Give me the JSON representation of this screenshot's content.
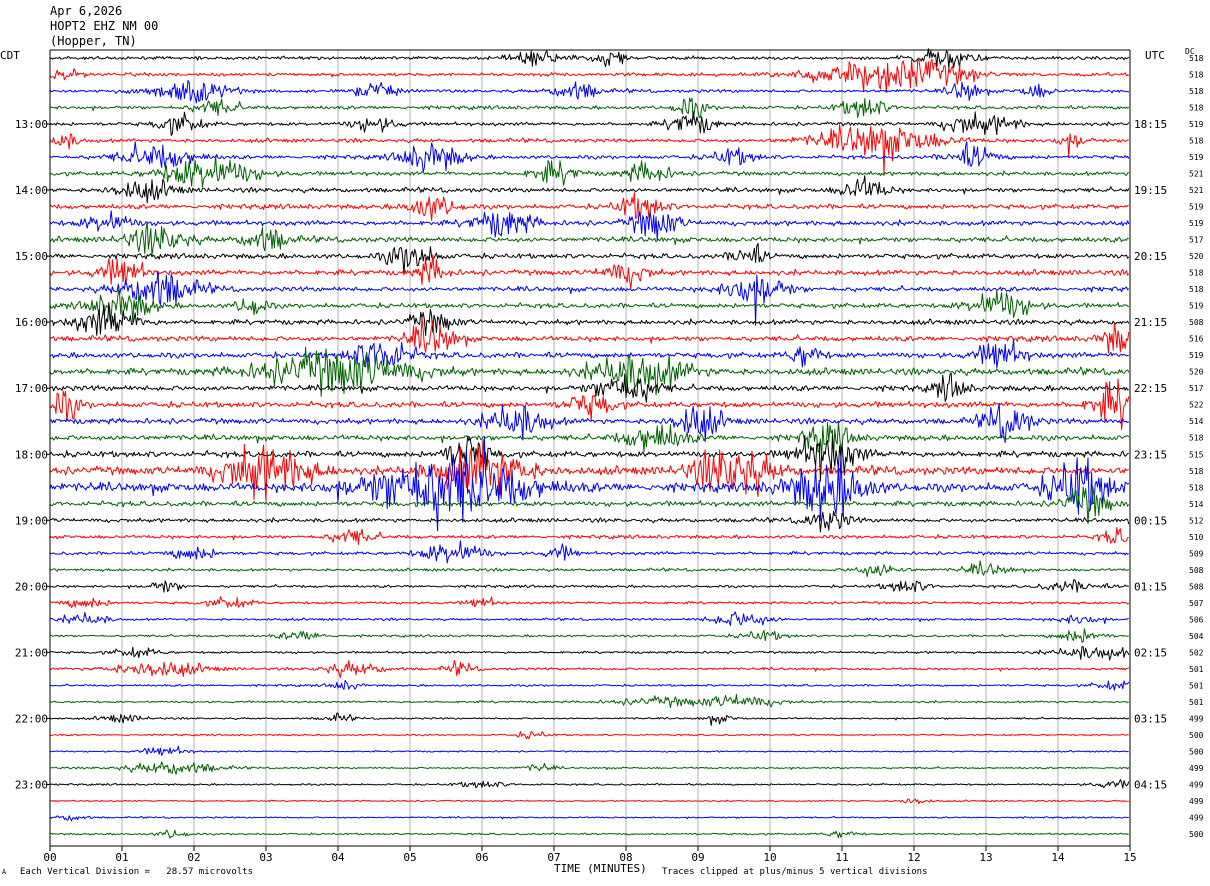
{
  "header": {
    "date": "Apr 6,2026",
    "station": "HOPT2 EHZ NM 00",
    "location": "(Hopper, TN)"
  },
  "axes": {
    "left_zone": "CDT",
    "right_zone": "UTC",
    "dc_label": "DC",
    "x_title": "TIME (MINUTES)"
  },
  "footer": {
    "scale_note": "Each Vertical Division =   28.57 microvolts",
    "clip_note": "Traces clipped at plus/minus 5 vertical divisions",
    "corner_mark": "A"
  },
  "chart_data": {
    "type": "line",
    "x_range": [
      0,
      15
    ],
    "x_ticks": [
      "00",
      "01",
      "02",
      "03",
      "04",
      "05",
      "06",
      "07",
      "08",
      "09",
      "10",
      "11",
      "12",
      "13",
      "14",
      "15"
    ],
    "row_count": 48,
    "color_cycle": [
      "#000000",
      "#ff0000",
      "#0000ff",
      "#006400"
    ],
    "left_time_labels": [
      {
        "row": 4,
        "label": "13:00"
      },
      {
        "row": 8,
        "label": "14:00"
      },
      {
        "row": 12,
        "label": "15:00"
      },
      {
        "row": 16,
        "label": "16:00"
      },
      {
        "row": 20,
        "label": "17:00"
      },
      {
        "row": 24,
        "label": "18:00"
      },
      {
        "row": 28,
        "label": "19:00"
      },
      {
        "row": 32,
        "label": "20:00"
      },
      {
        "row": 36,
        "label": "21:00"
      },
      {
        "row": 40,
        "label": "22:00"
      },
      {
        "row": 44,
        "label": "23:00"
      }
    ],
    "right_time_labels": [
      {
        "row": 4,
        "label": "18:15"
      },
      {
        "row": 8,
        "label": "19:15"
      },
      {
        "row": 12,
        "label": "20:15"
      },
      {
        "row": 16,
        "label": "21:15"
      },
      {
        "row": 20,
        "label": "22:15"
      },
      {
        "row": 24,
        "label": "23:15"
      },
      {
        "row": 28,
        "label": "00:15"
      },
      {
        "row": 32,
        "label": "01:15"
      },
      {
        "row": 36,
        "label": "02:15"
      },
      {
        "row": 40,
        "label": "03:15"
      },
      {
        "row": 44,
        "label": "04:15"
      }
    ],
    "dc_offsets": [
      "518",
      "518",
      "518",
      "518",
      "519",
      "518",
      "519",
      "521",
      "521",
      "519",
      "519",
      "517",
      "520",
      "518",
      "518",
      "519",
      "508",
      "516",
      "519",
      "520",
      "517",
      "522",
      "514",
      "518",
      "515",
      "518",
      "518",
      "514",
      "512",
      "510",
      "509",
      "508",
      "508",
      "507",
      "506",
      "504",
      "502",
      "501",
      "501",
      "501",
      "499",
      "500",
      "500",
      "499",
      "499",
      "499",
      "499",
      "500"
    ],
    "activity": [
      {
        "row": 0,
        "level": 1.2,
        "bursts": [
          [
            6.8,
            0.4,
            2
          ],
          [
            7.8,
            0.2,
            2.5
          ],
          [
            12.4,
            0.4,
            3
          ]
        ]
      },
      {
        "row": 1,
        "level": 1.3,
        "bursts": [
          [
            0.2,
            0.2,
            2
          ],
          [
            11.2,
            0.7,
            4
          ],
          [
            12.2,
            0.6,
            4
          ]
        ]
      },
      {
        "row": 2,
        "level": 1.3,
        "bursts": [
          [
            1.9,
            0.5,
            3.5
          ],
          [
            4.5,
            0.3,
            2
          ],
          [
            7.3,
            0.3,
            2.5
          ],
          [
            12.7,
            0.2,
            3
          ],
          [
            13.7,
            0.2,
            2
          ]
        ]
      },
      {
        "row": 3,
        "level": 1.4,
        "bursts": [
          [
            2.3,
            0.3,
            2
          ],
          [
            8.9,
            0.2,
            3
          ],
          [
            11.3,
            0.3,
            3
          ]
        ]
      },
      {
        "row": 4,
        "level": 1.4,
        "bursts": [
          [
            1.8,
            0.3,
            2.5
          ],
          [
            4.5,
            0.3,
            2
          ],
          [
            8.9,
            0.3,
            3
          ],
          [
            12.7,
            0.3,
            2.5
          ],
          [
            13.2,
            0.3,
            2
          ]
        ]
      },
      {
        "row": 5,
        "level": 1.5,
        "bursts": [
          [
            0.2,
            0.2,
            2
          ],
          [
            11.5,
            0.8,
            4
          ],
          [
            14.2,
            0.2,
            2
          ]
        ]
      },
      {
        "row": 6,
        "level": 1.5,
        "bursts": [
          [
            1.5,
            0.5,
            3
          ],
          [
            5.3,
            0.4,
            3.5
          ],
          [
            9.5,
            0.3,
            2
          ],
          [
            12.8,
            0.3,
            3
          ]
        ]
      },
      {
        "row": 7,
        "level": 1.6,
        "bursts": [
          [
            2.2,
            0.6,
            4
          ],
          [
            7.0,
            0.3,
            2.5
          ],
          [
            8.3,
            0.3,
            2.5
          ]
        ]
      },
      {
        "row": 8,
        "level": 1.8,
        "bursts": [
          [
            1.3,
            0.4,
            2
          ],
          [
            11.3,
            0.3,
            2.5
          ]
        ]
      },
      {
        "row": 9,
        "level": 1.9,
        "bursts": [
          [
            5.3,
            0.3,
            2.5
          ],
          [
            8.2,
            0.3,
            2.5
          ]
        ]
      },
      {
        "row": 10,
        "level": 2.0,
        "bursts": [
          [
            0.8,
            0.3,
            2
          ],
          [
            6.3,
            0.4,
            2.5
          ],
          [
            8.4,
            0.3,
            3
          ]
        ]
      },
      {
        "row": 11,
        "level": 2.1,
        "bursts": [
          [
            1.5,
            0.4,
            2.5
          ],
          [
            3.0,
            0.3,
            2
          ]
        ]
      },
      {
        "row": 12,
        "level": 2.0,
        "bursts": [
          [
            5.0,
            0.3,
            3
          ],
          [
            9.7,
            0.2,
            2.5
          ]
        ]
      },
      {
        "row": 13,
        "level": 2.1,
        "bursts": [
          [
            1.0,
            0.3,
            2.5
          ],
          [
            5.3,
            0.2,
            2.5
          ],
          [
            8.0,
            0.3,
            2
          ]
        ]
      },
      {
        "row": 14,
        "level": 1.9,
        "bursts": [
          [
            1.5,
            0.5,
            3.5
          ],
          [
            9.8,
            0.4,
            3.5
          ]
        ]
      },
      {
        "row": 15,
        "level": 1.9,
        "bursts": [
          [
            1.0,
            0.4,
            3
          ],
          [
            2.8,
            0.2,
            2
          ],
          [
            13.2,
            0.4,
            3
          ]
        ]
      },
      {
        "row": 16,
        "level": 2.0,
        "bursts": [
          [
            0.8,
            0.4,
            3
          ],
          [
            5.3,
            0.3,
            2
          ]
        ]
      },
      {
        "row": 17,
        "level": 2.1,
        "bursts": [
          [
            5.3,
            0.3,
            3
          ],
          [
            14.8,
            0.2,
            2.5
          ]
        ]
      },
      {
        "row": 18,
        "level": 2.2,
        "bursts": [
          [
            4.6,
            0.4,
            3
          ],
          [
            10.5,
            0.2,
            2
          ],
          [
            13.2,
            0.3,
            2.5
          ]
        ]
      },
      {
        "row": 19,
        "level": 2.6,
        "bursts": [
          [
            4.0,
            1.0,
            3
          ],
          [
            8.2,
            0.6,
            3
          ]
        ]
      },
      {
        "row": 20,
        "level": 2.2,
        "bursts": [
          [
            8.0,
            0.4,
            3
          ],
          [
            12.5,
            0.2,
            2
          ]
        ]
      },
      {
        "row": 21,
        "level": 2.3,
        "bursts": [
          [
            0.2,
            0.2,
            2.5
          ],
          [
            7.5,
            0.3,
            2
          ],
          [
            14.8,
            0.3,
            3.5
          ]
        ]
      },
      {
        "row": 22,
        "level": 2.2,
        "bursts": [
          [
            6.5,
            0.4,
            3
          ],
          [
            9.0,
            0.3,
            3
          ],
          [
            13.3,
            0.3,
            3
          ]
        ]
      },
      {
        "row": 23,
        "level": 2.2,
        "bursts": [
          [
            8.4,
            0.4,
            2.5
          ],
          [
            10.8,
            0.3,
            2.5
          ]
        ]
      },
      {
        "row": 24,
        "level": 2.4,
        "bursts": [
          [
            5.8,
            0.3,
            3
          ],
          [
            10.8,
            0.4,
            3.5
          ]
        ]
      },
      {
        "row": 25,
        "level": 3.2,
        "bursts": [
          [
            3.0,
            0.6,
            3
          ],
          [
            6.0,
            0.6,
            3
          ],
          [
            9.5,
            0.5,
            3
          ]
        ]
      },
      {
        "row": 26,
        "level": 3.5,
        "bursts": [
          [
            5.5,
            1.0,
            4
          ],
          [
            10.8,
            0.5,
            3
          ],
          [
            14.3,
            0.4,
            3
          ]
        ]
      },
      {
        "row": 27,
        "level": 2.0,
        "bursts": [
          [
            14.4,
            0.3,
            3
          ]
        ]
      },
      {
        "row": 28,
        "level": 1.6,
        "bursts": [
          [
            10.8,
            0.3,
            2.5
          ]
        ]
      },
      {
        "row": 29,
        "level": 1.4,
        "bursts": [
          [
            4.2,
            0.3,
            2
          ],
          [
            14.8,
            0.2,
            2
          ]
        ]
      },
      {
        "row": 30,
        "level": 1.3,
        "bursts": [
          [
            2.0,
            0.3,
            2
          ],
          [
            5.6,
            0.4,
            3.5
          ],
          [
            7.1,
            0.2,
            2
          ]
        ]
      },
      {
        "row": 31,
        "level": 1.1,
        "bursts": [
          [
            11.5,
            0.3,
            2.5
          ],
          [
            13.0,
            0.3,
            2
          ]
        ]
      },
      {
        "row": 32,
        "level": 1.0,
        "bursts": [
          [
            1.6,
            0.2,
            2.5
          ],
          [
            11.9,
            0.3,
            2.5
          ],
          [
            14.2,
            0.4,
            2
          ]
        ]
      },
      {
        "row": 33,
        "level": 1.0,
        "bursts": [
          [
            0.5,
            0.3,
            2
          ],
          [
            2.5,
            0.3,
            2
          ],
          [
            6.0,
            0.2,
            2
          ]
        ]
      },
      {
        "row": 34,
        "level": 0.9,
        "bursts": [
          [
            0.5,
            0.3,
            2.5
          ],
          [
            9.6,
            0.4,
            3.5
          ],
          [
            14.3,
            0.3,
            2
          ]
        ]
      },
      {
        "row": 35,
        "level": 0.9,
        "bursts": [
          [
            3.5,
            0.3,
            2
          ],
          [
            9.9,
            0.3,
            2
          ],
          [
            14.3,
            0.3,
            3
          ]
        ]
      },
      {
        "row": 36,
        "level": 0.9,
        "bursts": [
          [
            1.2,
            0.3,
            2
          ],
          [
            14.5,
            0.5,
            3
          ]
        ]
      },
      {
        "row": 37,
        "level": 1.0,
        "bursts": [
          [
            1.5,
            0.6,
            3
          ],
          [
            4.2,
            0.4,
            2.5
          ],
          [
            5.7,
            0.2,
            2
          ]
        ]
      },
      {
        "row": 38,
        "level": 0.8,
        "bursts": [
          [
            4.1,
            0.2,
            2
          ],
          [
            14.8,
            0.3,
            2
          ]
        ]
      },
      {
        "row": 39,
        "level": 0.8,
        "bursts": [
          [
            8.5,
            0.6,
            2
          ],
          [
            9.6,
            0.5,
            3
          ]
        ]
      },
      {
        "row": 40,
        "level": 0.7,
        "bursts": [
          [
            1.0,
            0.3,
            2
          ],
          [
            4.0,
            0.2,
            2
          ],
          [
            9.3,
            0.2,
            2
          ]
        ]
      },
      {
        "row": 41,
        "level": 0.6,
        "bursts": [
          [
            6.7,
            0.2,
            2.5
          ]
        ]
      },
      {
        "row": 42,
        "level": 0.6,
        "bursts": [
          [
            1.6,
            0.3,
            3
          ]
        ]
      },
      {
        "row": 43,
        "level": 0.7,
        "bursts": [
          [
            1.7,
            0.6,
            3.5
          ],
          [
            6.8,
            0.2,
            2
          ]
        ]
      },
      {
        "row": 44,
        "level": 0.7,
        "bursts": [
          [
            6.0,
            0.3,
            2
          ],
          [
            14.8,
            0.3,
            2
          ]
        ]
      },
      {
        "row": 45,
        "level": 0.6,
        "bursts": [
          [
            12.0,
            0.2,
            2
          ]
        ]
      },
      {
        "row": 46,
        "level": 0.6,
        "bursts": [
          [
            0.3,
            0.2,
            2
          ]
        ]
      },
      {
        "row": 47,
        "level": 0.7,
        "bursts": [
          [
            1.7,
            0.2,
            2.5
          ],
          [
            11.0,
            0.2,
            2
          ]
        ]
      }
    ]
  }
}
